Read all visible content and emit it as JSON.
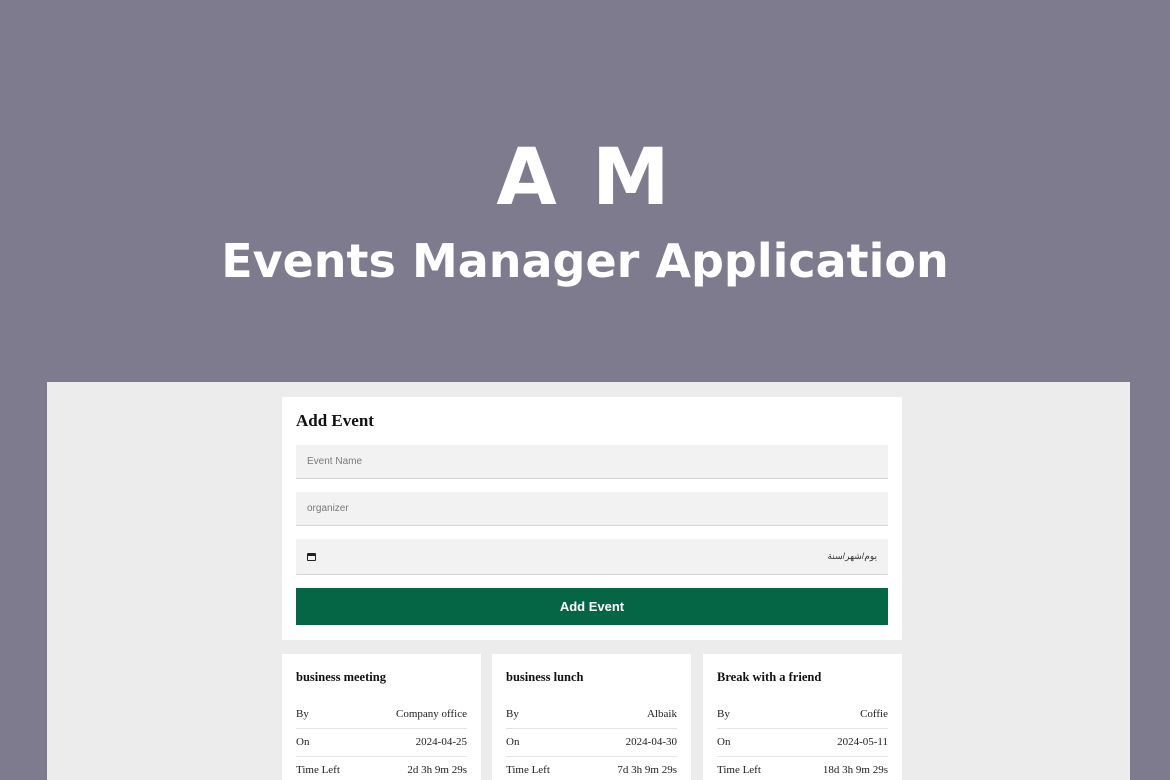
{
  "hero": {
    "logo": "A M",
    "subtitle": "Events Manager Application"
  },
  "form": {
    "title": "Add Event",
    "event_name_placeholder": "Event Name",
    "organizer_placeholder": "organizer",
    "date_placeholder": "يوم/شهر/سنة",
    "submit_label": "Add Event"
  },
  "events": [
    {
      "name": "business meeting",
      "by_label": "By",
      "by": "Company office",
      "on_label": "On",
      "on": "2024-04-25",
      "left_label": "Time Left",
      "left": "2d 3h 9m 29s"
    },
    {
      "name": "business lunch",
      "by_label": "By",
      "by": "Albaik",
      "on_label": "On",
      "on": "2024-04-30",
      "left_label": "Time Left",
      "left": "7d 3h 9m 29s"
    },
    {
      "name": "Break with a friend",
      "by_label": "By",
      "by": "Coffie",
      "on_label": "On",
      "on": "2024-05-11",
      "left_label": "Time Left",
      "left": "18d 3h 9m 29s"
    }
  ],
  "colors": {
    "background": "#7e7b8f",
    "button": "#056645"
  }
}
